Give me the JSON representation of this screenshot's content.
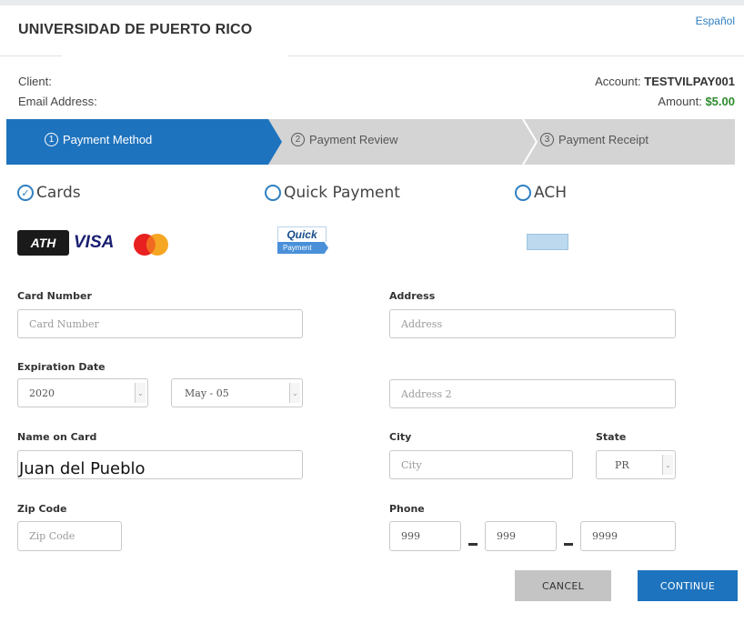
{
  "header": {
    "title": "UNIVERSIDAD DE PUERTO RICO",
    "language_link": "Español",
    "client_label": "Client: ",
    "email_label": "Email Address:",
    "account_label": "Account: ",
    "account_value": "TESTVILPAY001",
    "amount_label": "Amount: ",
    "amount_value": "$5.00"
  },
  "steps": [
    {
      "num": "1",
      "label": "Payment Method",
      "active": true
    },
    {
      "num": "2",
      "label": "Payment Review",
      "active": false
    },
    {
      "num": "3",
      "label": "Payment Receipt",
      "active": false
    }
  ],
  "payment_methods": [
    {
      "label": "Cards",
      "selected": true
    },
    {
      "label": "Quick Payment",
      "selected": false
    },
    {
      "label": "ACH",
      "selected": false
    }
  ],
  "logos": {
    "ath": "ATH",
    "visa": "VISA",
    "mastercard": "MasterCard",
    "quick_top": "Quick",
    "quick_bottom": "Payment"
  },
  "form": {
    "card_number": {
      "label": "Card Number",
      "placeholder": "Card Number"
    },
    "expiration": {
      "label": "Expiration Date",
      "year": "2020",
      "month": "May - 05"
    },
    "name_on_card": {
      "label": "Name on Card",
      "value": "Juan del Pueblo"
    },
    "zip": {
      "label": "Zip Code",
      "placeholder": "Zip Code"
    },
    "address": {
      "label": "Address",
      "placeholder": "Address"
    },
    "address2": {
      "placeholder": "Address 2"
    },
    "city": {
      "label": "City",
      "placeholder": "City"
    },
    "state": {
      "label": "State",
      "value": "PR"
    },
    "phone": {
      "label": "Phone",
      "part1": "999",
      "part2": "999",
      "part3": "9999"
    }
  },
  "buttons": {
    "cancel": "CANCEL",
    "continue": "CONTINUE"
  },
  "colors": {
    "accent": "#1e73be",
    "amount": "#2e8b2e",
    "step_inactive": "#d4d4d4"
  }
}
